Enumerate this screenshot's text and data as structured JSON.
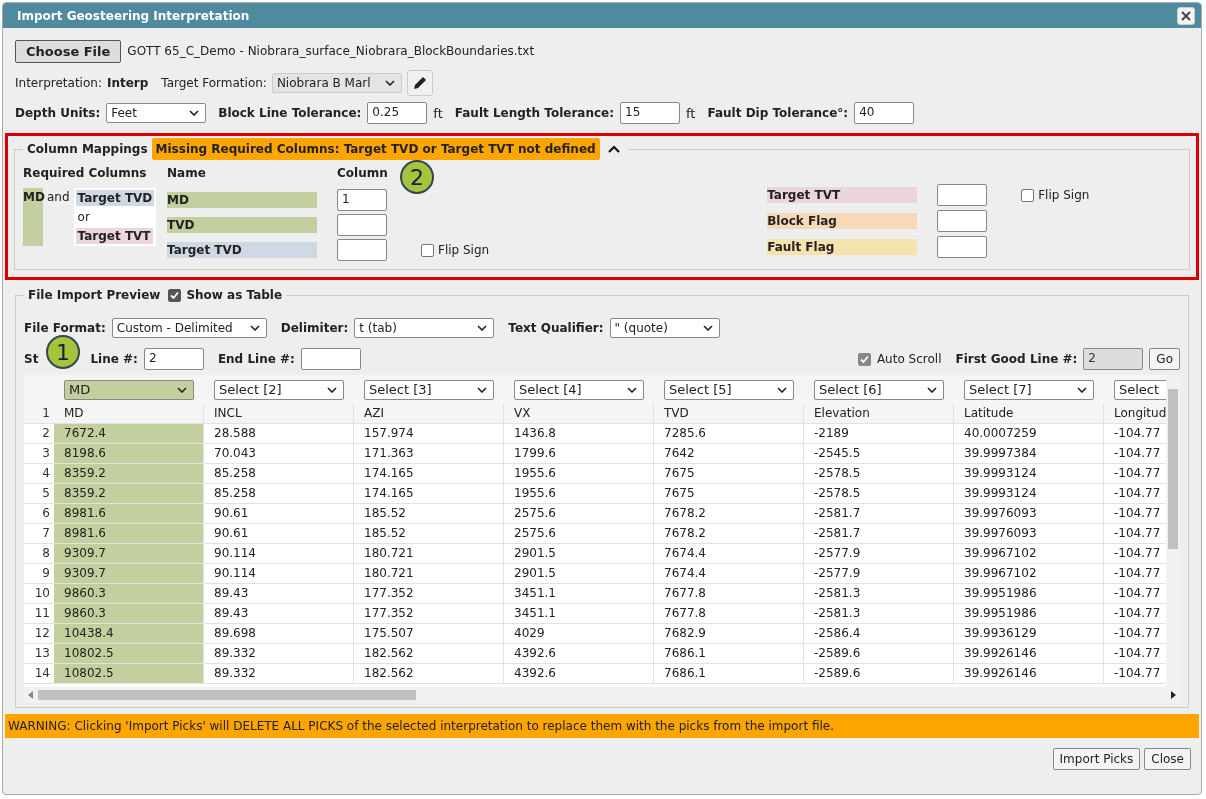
{
  "window": {
    "title": "Import Geosteering Interpretation"
  },
  "file": {
    "button": "Choose File",
    "name": "GOTT 65_C_Demo - Niobrara_surface_Niobrara_BlockBoundaries.txt"
  },
  "interpretation": {
    "label": "Interpretation:",
    "value": "Interp"
  },
  "target_formation": {
    "label": "Target Formation:",
    "value": "Niobrara B Marl"
  },
  "tolerances": [
    {
      "label": "Depth Units:",
      "kind": "select",
      "value": "Feet"
    },
    {
      "label": "Block Line Tolerance:",
      "kind": "input",
      "value": "0.25",
      "unit": "ft"
    },
    {
      "label": "Fault Length Tolerance:",
      "kind": "input",
      "value": "15",
      "unit": "ft"
    },
    {
      "label": "Fault Dip Tolerance°:",
      "kind": "input",
      "value": "40"
    }
  ],
  "column_mappings": {
    "legend": "Column Mappings",
    "alert": "Missing Required Columns: Target TVD or Target TVT not defined",
    "expanded": true,
    "required_heading": "Required Columns",
    "name_heading": "Name",
    "column_heading": "Column",
    "required": {
      "md": "MD",
      "and": "and",
      "tvd": "Target TVD",
      "or": "or",
      "tvt": "Target TVT"
    },
    "left": [
      {
        "name": "MD",
        "color": "#c2cf9e",
        "value": "1"
      },
      {
        "name": "TVD",
        "color": "#c2cf9e"
      },
      {
        "name": "Target TVD",
        "color": "#cfd9e6",
        "flip": {
          "label": "Flip Sign",
          "checked": false
        }
      }
    ],
    "right": [
      {
        "name": "Target TVT",
        "color": "#ecd5de",
        "flip": {
          "label": "Flip Sign",
          "checked": false
        }
      },
      {
        "name": "Block Flag",
        "color": "#f7d9b8"
      },
      {
        "name": "Fault Flag",
        "color": "#f5e3ad"
      }
    ]
  },
  "preview": {
    "legend": "File Import Preview",
    "show_as_table": {
      "label": "Show as Table",
      "checked": true
    },
    "file_format": {
      "label": "File Format:",
      "value": "Custom - Delimited"
    },
    "delimiter": {
      "label": "Delimiter:",
      "value": "t (tab)"
    },
    "text_qualifier": {
      "label": "Text Qualifier:",
      "value": "\" (quote)"
    },
    "start_line": {
      "label_start": "St",
      "label_end": "Line #:",
      "value": "2"
    },
    "end_line": {
      "label": "End Line #:"
    },
    "auto_scroll": {
      "label": "Auto Scroll",
      "checked": true
    },
    "first_good_line": {
      "label": "First Good Line #:",
      "value": "2"
    },
    "go": "Go",
    "column_selects": [
      {
        "value": "MD",
        "selected": true
      },
      {
        "value": "Select [2]",
        "selected": false
      },
      {
        "value": "Select [3]",
        "selected": false
      },
      {
        "value": "Select [4]",
        "selected": false
      },
      {
        "value": "Select [5]",
        "selected": false
      },
      {
        "value": "Select [6]",
        "selected": false
      },
      {
        "value": "Select [7]",
        "selected": false
      },
      {
        "value": "Select",
        "selected": false
      }
    ],
    "rows": [
      {
        "number": "1",
        "cells": [
          "MD",
          "INCL",
          "AZI",
          "VX",
          "TVD",
          "Elevation",
          "Latitude",
          "Longitud"
        ]
      },
      {
        "number": "2",
        "cells": [
          "7672.4",
          "28.588",
          "157.974",
          "1436.8",
          "7285.6",
          "-2189",
          "40.0007259",
          "-104.77"
        ]
      },
      {
        "number": "3",
        "cells": [
          "8198.6",
          "70.043",
          "171.363",
          "1799.6",
          "7642",
          "-2545.5",
          "39.9997384",
          "-104.77"
        ]
      },
      {
        "number": "4",
        "cells": [
          "8359.2",
          "85.258",
          "174.165",
          "1955.6",
          "7675",
          "-2578.5",
          "39.9993124",
          "-104.77"
        ]
      },
      {
        "number": "5",
        "cells": [
          "8359.2",
          "85.258",
          "174.165",
          "1955.6",
          "7675",
          "-2578.5",
          "39.9993124",
          "-104.77"
        ]
      },
      {
        "number": "6",
        "cells": [
          "8981.6",
          "90.61",
          "185.52",
          "2575.6",
          "7678.2",
          "-2581.7",
          "39.9976093",
          "-104.77"
        ]
      },
      {
        "number": "7",
        "cells": [
          "8981.6",
          "90.61",
          "185.52",
          "2575.6",
          "7678.2",
          "-2581.7",
          "39.9976093",
          "-104.77"
        ]
      },
      {
        "number": "8",
        "cells": [
          "9309.7",
          "90.114",
          "180.721",
          "2901.5",
          "7674.4",
          "-2577.9",
          "39.9967102",
          "-104.77"
        ]
      },
      {
        "number": "9",
        "cells": [
          "9309.7",
          "90.114",
          "180.721",
          "2901.5",
          "7674.4",
          "-2577.9",
          "39.9967102",
          "-104.77"
        ]
      },
      {
        "number": "10",
        "cells": [
          "9860.3",
          "89.43",
          "177.352",
          "3451.1",
          "7677.8",
          "-2581.3",
          "39.9951986",
          "-104.77"
        ]
      },
      {
        "number": "11",
        "cells": [
          "9860.3",
          "89.43",
          "177.352",
          "3451.1",
          "7677.8",
          "-2581.3",
          "39.9951986",
          "-104.77"
        ]
      },
      {
        "number": "12",
        "cells": [
          "10438.4",
          "89.698",
          "175.507",
          "4029",
          "7682.9",
          "-2586.4",
          "39.9936129",
          "-104.77"
        ]
      },
      {
        "number": "13",
        "cells": [
          "10802.5",
          "89.332",
          "182.562",
          "4392.6",
          "7686.1",
          "-2589.6",
          "39.9926146",
          "-104.77"
        ]
      },
      {
        "number": "14",
        "cells": [
          "10802.5",
          "89.332",
          "182.562",
          "4392.6",
          "7686.1",
          "-2589.6",
          "39.9926146",
          "-104.77"
        ]
      }
    ]
  },
  "warning": "WARNING: Clicking 'Import Picks' will DELETE ALL PICKS of the selected interpretation to replace them with the picks from the import file.",
  "buttons": [
    "Import Picks",
    "Close"
  ],
  "callouts": [
    "1",
    "2"
  ]
}
